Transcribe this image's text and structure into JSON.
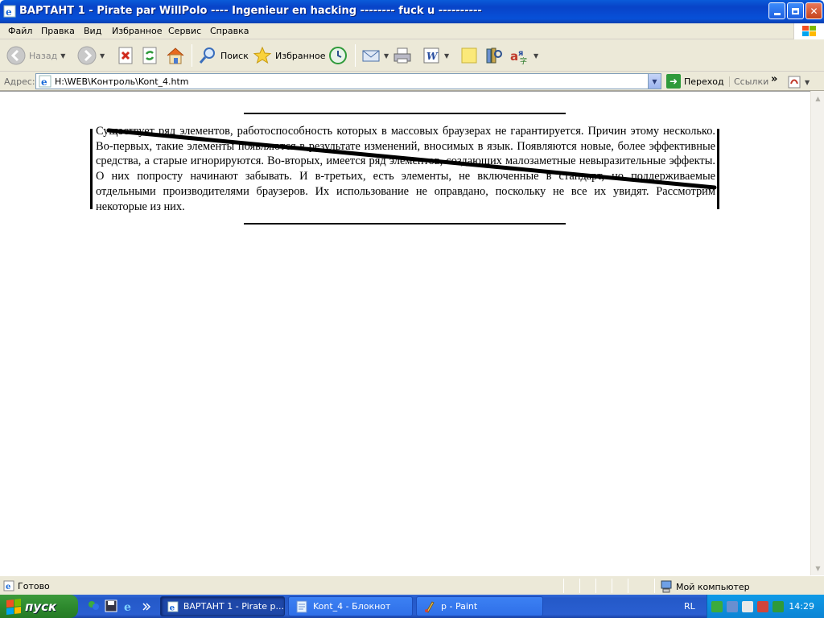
{
  "window": {
    "title": "ВАРТАНТ 1 - Pirate par WillPolo ---- Ingenieur en hacking -------- fuck u ----------"
  },
  "menu": [
    "Файл",
    "Правка",
    "Вид",
    "Избранное",
    "Сервис",
    "Справка"
  ],
  "toolbar": {
    "back_label": "Назад",
    "search_label": "Поиск",
    "favorites_label": "Избранное"
  },
  "address": {
    "label": "Адрес:",
    "value": "H:\\WEB\\Контроль\\Kont_4.htm",
    "go_label": "Переход",
    "links_label": "Ссылки"
  },
  "page": {
    "paragraph": "Существует ряд элементов, работоспособность которых в массовых браузерах не гарантируется. Причин этому несколько. Во-первых, такие элементы появляются в результате изменений, вносимых в язык. Появляются новые, более эффективные средства, а старые игнорируются. Во-вторых, имеется ряд элементов, создающих малозаметные невыразительные эффекты. О них попросту начинают забывать. И в-третьих, есть элементы, не включенные в стандарт, но поддерживаемые отдельными производителями браузеров. Их использование не оправдано, поскольку не все их увидят. Рассмотрим некоторые из них."
  },
  "status": {
    "text": "Готово",
    "zone": "Мой компьютер"
  },
  "taskbar": {
    "start_label": "пуск",
    "tasks": [
      {
        "label": "ВАРТАНТ 1 - Pirate p...",
        "active": true
      },
      {
        "label": "Kont_4 - Блокнот",
        "active": false
      },
      {
        "label": "p - Paint",
        "active": false
      }
    ],
    "lang": "RL",
    "clock": "14:29"
  },
  "colors": {
    "title_blue": "#0843c8",
    "taskbar_blue": "#2459c8",
    "start_green": "#2e8a2e",
    "tray_blue": "#0c84d4",
    "chrome_beige": "#ece9d8"
  }
}
